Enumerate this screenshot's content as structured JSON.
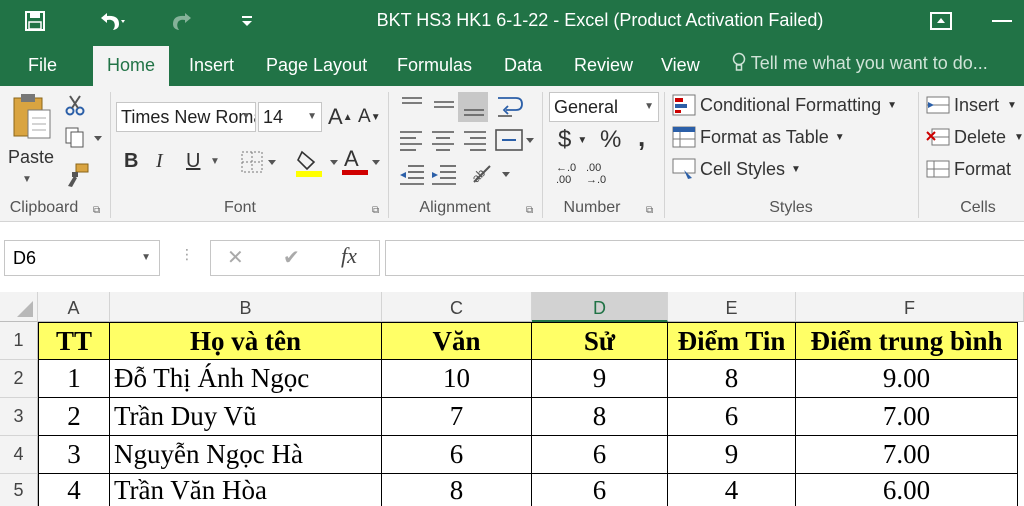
{
  "window": {
    "title": "BKT HS3 HK1 6-1-22 - Excel (Product Activation Failed)"
  },
  "quick_access": {
    "save_icon": "save-icon",
    "undo_icon": "undo-icon",
    "redo_icon": "redo-icon",
    "customize_icon": "customize-qat-icon"
  },
  "tabs": [
    {
      "label": "File"
    },
    {
      "label": "Home"
    },
    {
      "label": "Insert"
    },
    {
      "label": "Page Layout"
    },
    {
      "label": "Formulas"
    },
    {
      "label": "Data"
    },
    {
      "label": "Review"
    },
    {
      "label": "View"
    }
  ],
  "tell_me": "Tell me what you want to do...",
  "ribbon": {
    "clipboard": {
      "label": "Clipboard",
      "paste": "Paste"
    },
    "font": {
      "label": "Font",
      "name": "Times New Roman",
      "size": "14",
      "bold": "B",
      "italic": "I",
      "underline": "U",
      "grow": "A",
      "shrink": "A"
    },
    "alignment": {
      "label": "Alignment"
    },
    "number": {
      "label": "Number",
      "format": "General",
      "currency": "$",
      "percent": "%",
      "comma": ",",
      "inc_decimal": "←.0 .00",
      "dec_decimal": ".00 →.0"
    },
    "styles": {
      "label": "Styles",
      "conditional": "Conditional Formatting",
      "format_table": "Format as Table",
      "cell_styles": "Cell Styles"
    },
    "cells": {
      "label": "Cells",
      "insert": "Insert",
      "delete": "Delete",
      "format": "Format"
    }
  },
  "formula_bar": {
    "name_box": "D6",
    "cancel": "✕",
    "enter": "✔",
    "fx": "fx",
    "value": ""
  },
  "sheet": {
    "columns": [
      "A",
      "B",
      "C",
      "D",
      "E",
      "F"
    ],
    "selected_column": "D",
    "row_numbers": [
      "1",
      "2",
      "3",
      "4",
      "5"
    ],
    "header": [
      "TT",
      "Họ và tên",
      "Văn",
      "Sử",
      "Điểm Tin",
      "Điểm trung bình"
    ],
    "rows": [
      [
        "1",
        "Đỗ Thị Ánh Ngọc",
        "10",
        "9",
        "8",
        "9.00"
      ],
      [
        "2",
        "Trần Duy Vũ",
        "7",
        "8",
        "6",
        "7.00"
      ],
      [
        "3",
        "Nguyễn Ngọc Hà",
        "6",
        "6",
        "9",
        "7.00"
      ],
      [
        "4",
        "Trần Văn Hòa",
        "8",
        "6",
        "4",
        "6.00"
      ]
    ]
  },
  "colors": {
    "accent": "#217346",
    "header_fill": "#ffff66"
  }
}
